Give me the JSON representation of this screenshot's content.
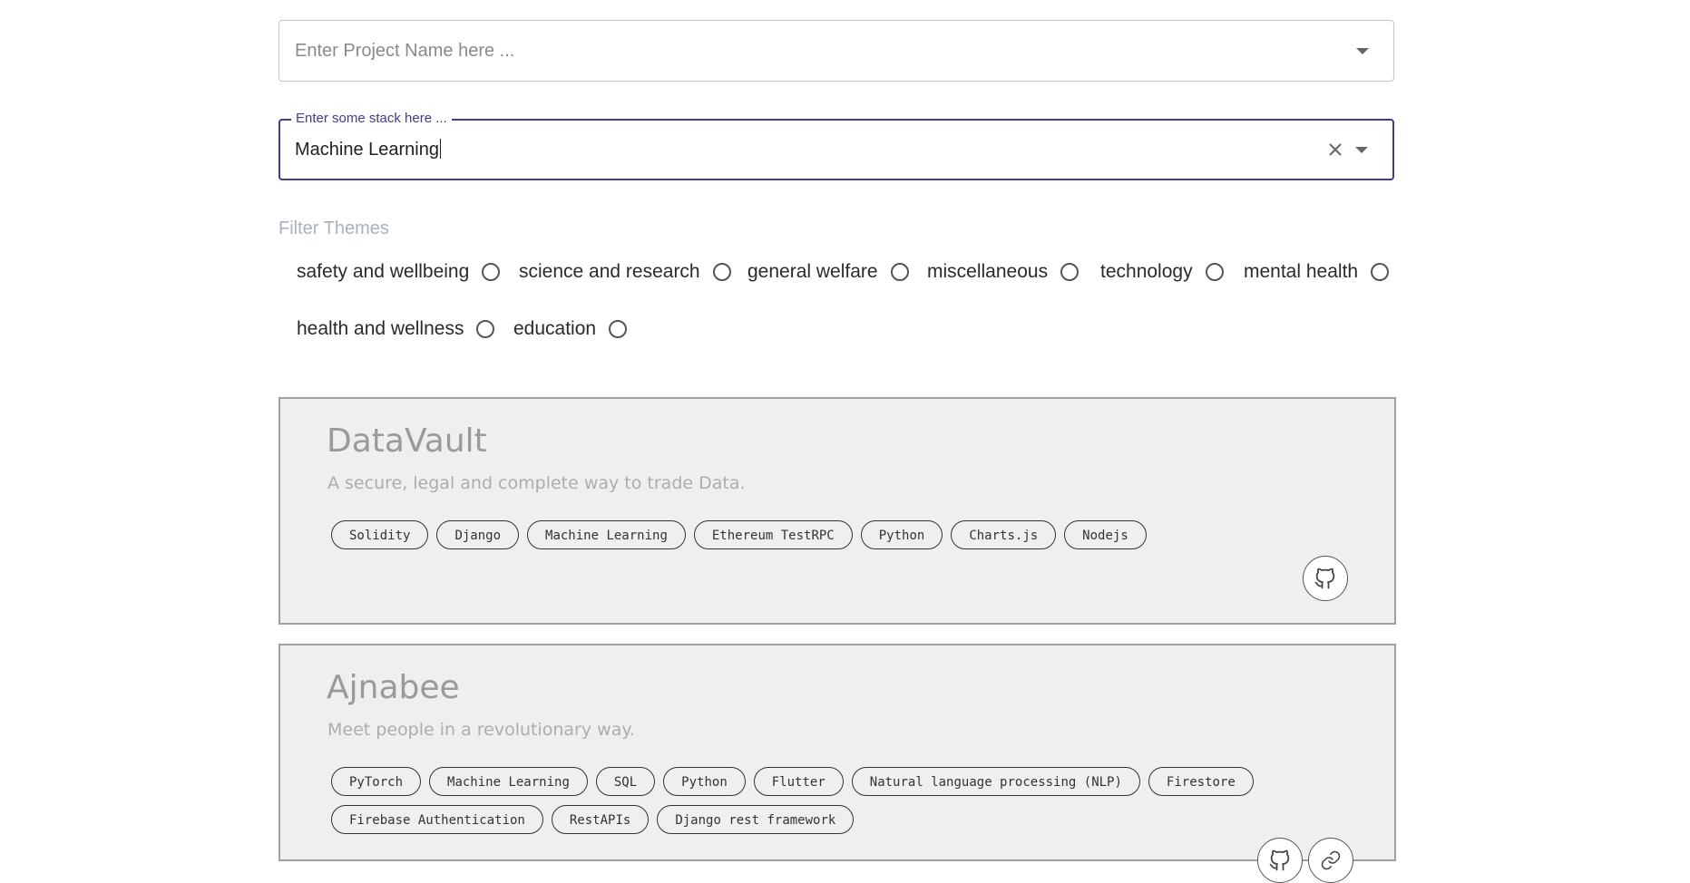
{
  "project_field": {
    "placeholder": "Enter Project Name here ..."
  },
  "stack_field": {
    "label": "Enter some stack here ...",
    "value": "Machine Learning"
  },
  "filter": {
    "heading": "Filter Themes",
    "themes": [
      "safety and wellbeing",
      "science and research",
      "general welfare",
      "miscellaneous",
      "technology",
      "mental health",
      "health and wellness",
      "education"
    ]
  },
  "projects": [
    {
      "title": "DataVault",
      "description": "A secure, legal and complete way to trade Data.",
      "tags": [
        "Solidity",
        "Django",
        "Machine Learning",
        "Ethereum TestRPC",
        "Python",
        "Charts.js",
        "Nodejs"
      ]
    },
    {
      "title": "Ajnabee",
      "description": "Meet people in a revolutionary way.",
      "tags": [
        "PyTorch",
        "Machine Learning",
        "SQL",
        "Python",
        "Flutter",
        "Natural language processing (NLP)",
        "Firestore",
        "Firebase Authentication",
        "RestAPIs",
        "Django rest framework"
      ]
    }
  ],
  "icons": {
    "dropdown": "chevron-down-icon",
    "clear": "close-icon",
    "radio": "radio-unchecked-icon",
    "github": "github-icon"
  }
}
